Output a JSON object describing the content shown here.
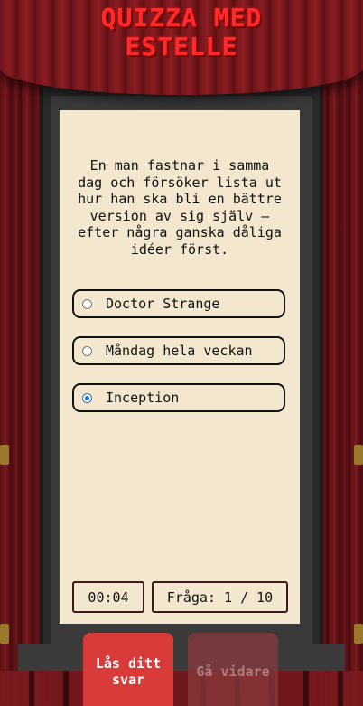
{
  "app": {
    "title_line1": "QUIZZA MED",
    "title_line2": "ESTELLE"
  },
  "quiz": {
    "question": "En man fastnar i samma dag och försöker lista ut hur han ska bli en bättre version av sig själv – efter några ganska dåliga idéer först.",
    "options": [
      {
        "label": "Doctor Strange",
        "selected": false
      },
      {
        "label": "Måndag hela veckan",
        "selected": false
      },
      {
        "label": "Inception",
        "selected": true
      }
    ],
    "timer": "00:04",
    "progress": "Fråga: 1 / 10"
  },
  "actions": {
    "lock_answer": "Lås ditt svar",
    "next": "Gå vidare"
  },
  "colors": {
    "title": "#ff2b2b",
    "panel": "#f3e7cf",
    "lock_button": "#d93a3a",
    "next_button_disabled": "#8a3a3e",
    "curtain": "#6e151a"
  }
}
